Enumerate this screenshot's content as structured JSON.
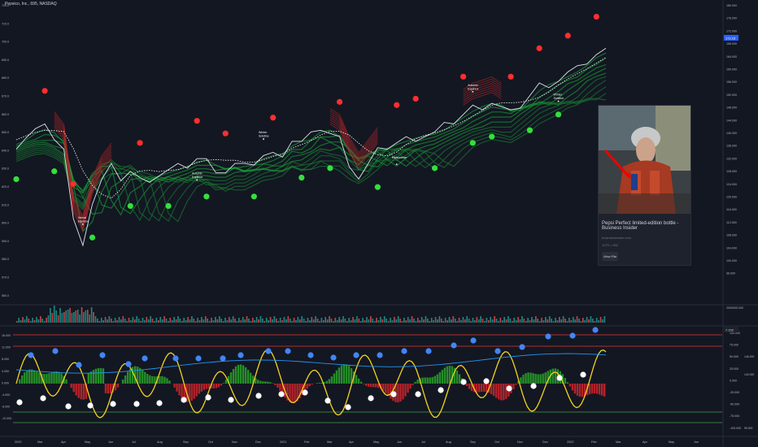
{
  "header": {
    "title": "Pepsico, Inc., 695, NASDAQ"
  },
  "card": {
    "title": "Pepsi Perfect limited-edition bottle - Business Insider",
    "source": "businessinsider.com",
    "dims": "1070 × 802",
    "button": "View File"
  },
  "chart_data": [
    {
      "type": "line",
      "panel": "price",
      "left_axis_ticks": [
        "720.0",
        "710.0",
        "700.0",
        "690.0",
        "680.0",
        "670.0",
        "660.0",
        "650.0",
        "640.0",
        "630.0",
        "620.0",
        "610.0",
        "600.0",
        "590.0",
        "580.0",
        "570.0",
        "560.0"
      ],
      "right_axis_ticks": [
        "180.000",
        "176.000",
        "172.000",
        "168.000",
        "164.000",
        "160.000",
        "156.000",
        "152.000",
        "148.000",
        "144.000",
        "140.000",
        "136.000",
        "132.000",
        "128.000",
        "124.000",
        "120.000",
        "116.000",
        "112.000",
        "108.000",
        "104.000",
        "100.000",
        "96.000"
      ],
      "right_price_label": "172.15",
      "x_ticks": [
        "2020",
        "Mar",
        "Apr",
        "May",
        "Jun",
        "Jul",
        "Aug",
        "Sep",
        "Oct",
        "Nov",
        "Dec",
        "2021",
        "Feb",
        "Mar",
        "Apr",
        "May",
        "Jun",
        "Jul",
        "Aug",
        "Sep",
        "Oct",
        "Nov",
        "Dec",
        "2022",
        "Feb",
        "Mar",
        "Apr",
        "May",
        "Jun"
      ],
      "close": [
        144.5,
        147,
        149,
        149.5,
        147,
        143,
        120,
        114,
        126,
        133,
        137,
        134,
        136,
        133,
        134,
        135,
        136,
        137,
        138,
        140,
        139,
        137,
        136,
        138,
        137,
        139,
        141,
        141,
        142,
        146,
        145,
        147,
        150,
        148,
        146,
        139,
        134,
        138,
        142,
        144,
        145,
        146,
        147,
        147.5,
        148,
        150,
        152,
        154,
        156,
        157,
        158,
        156,
        154,
        157,
        160,
        163,
        164,
        165,
        167,
        168,
        171,
        173,
        174
      ],
      "markers": [
        {
          "label": "Vernal Equinox",
          "color": "#ffffff"
        },
        {
          "label": "Autumn Equinox",
          "color": "#ffffff"
        },
        {
          "label": "Winter Solstice",
          "color": "#ffffff"
        },
        {
          "label": "Midsummer",
          "color": "#ffffff"
        },
        {
          "label": "Autumn Equinox",
          "color": "#ffffff"
        },
        {
          "label": "Winter Solstice",
          "color": "#ffffff"
        }
      ],
      "colors": {
        "price": "#e0e3eb",
        "sell_dot": "#ff2e2e",
        "buy_dot": "#33e03c",
        "ribbon_up": "#18b83b",
        "ribbon_down": "#b3262a",
        "white_dotted": "#ffffff"
      },
      "volume_axis": "2000000.000"
    },
    {
      "type": "line",
      "panel": "oscillator",
      "left_axis_ticks": [
        "16.000",
        "12.000",
        "8.000",
        "4.000",
        "0.000",
        "-4.000",
        "-8.000",
        "-12.000"
      ],
      "right_axis_ticks": [
        "100.000",
        "75.000",
        "50.000",
        "25.000",
        "0.000",
        "-25.000",
        "-50.000",
        "-75.000",
        "-100.000"
      ],
      "right_label_top": "7.152",
      "right_label_mid": "146.000",
      "right_label_low": "140.000",
      "right_label_bottom": "95.000",
      "colors": {
        "osc": "#f5d31d",
        "signal": "#2196f3",
        "hist_up": "#29a329",
        "hist_down": "#d1252b",
        "top_dot": "#4285f4",
        "bottom_dot": "#ffffff",
        "red_line": "#e53935",
        "green_line": "#43a047"
      }
    }
  ]
}
